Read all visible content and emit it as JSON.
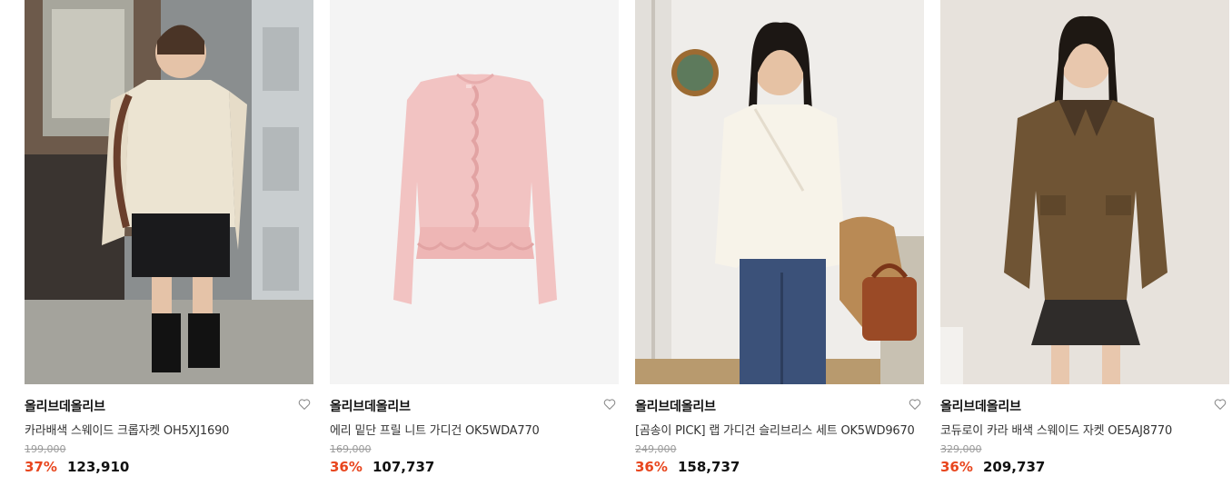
{
  "products": [
    {
      "brand": "올리브데올리브",
      "name": "카라배색 스웨이드 크롭자켓 OH5XJ1690",
      "original_price": "199,000",
      "discount_rate": "37%",
      "sale_price": "123,910",
      "image_icon": "product-photo-cream-crop-jacket",
      "wish_icon": "heart-outline-icon"
    },
    {
      "brand": "올리브데올리브",
      "name": "에리 밑단 프릴 니트 가디건 OK5WDA770",
      "original_price": "169,000",
      "discount_rate": "36%",
      "sale_price": "107,737",
      "image_icon": "product-photo-pink-frill-cardigan",
      "wish_icon": "heart-outline-icon"
    },
    {
      "brand": "올리브데올리브",
      "name": "[곰송이 PICK] 랩 가디건 슬리브리스 세트 OK5WD9670",
      "original_price": "249,000",
      "discount_rate": "36%",
      "sale_price": "158,737",
      "image_icon": "product-photo-ivory-wrap-cardigan",
      "wish_icon": "heart-outline-icon"
    },
    {
      "brand": "올리브데올리브",
      "name": "코듀로이 카라 배색 스웨이드 자켓 OE5AJ8770",
      "original_price": "329,000",
      "discount_rate": "36%",
      "sale_price": "209,737",
      "image_icon": "product-photo-brown-suede-jacket",
      "wish_icon": "heart-outline-icon"
    }
  ],
  "colors": {
    "discount": "#e8461e",
    "brand_text": "#111111",
    "name_text": "#333333",
    "strike_text": "#9a9a9a"
  }
}
